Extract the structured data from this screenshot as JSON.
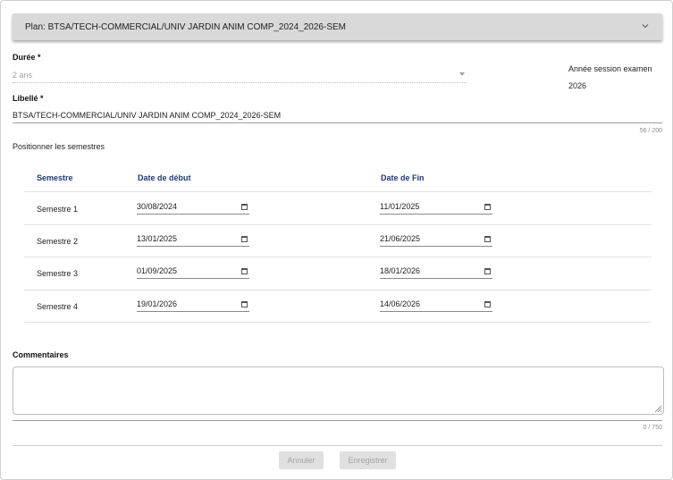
{
  "plan_header": {
    "title": "Plan: BTSA/TECH-COMMERCIAL/UNIV JARDIN ANIM COMP_2024_2026-SEM"
  },
  "duree": {
    "label": "Durée *",
    "value": "2 ans"
  },
  "annee_session": {
    "label": "Année session examen",
    "value": "2026"
  },
  "libelle": {
    "label": "Libellé *",
    "value": "BTSA/TECH-COMMERCIAL/UNIV JARDIN ANIM COMP_2024_2026-SEM",
    "counter": "56 / 200"
  },
  "semestres": {
    "section_label": "Positionner les semestres",
    "headers": {
      "semestre": "Semestre",
      "debut": "Date de début",
      "fin": "Date de Fin"
    },
    "rows": [
      {
        "name": "Semestre 1",
        "debut": "30/08/2024",
        "fin": "11/01/2025"
      },
      {
        "name": "Semestre 2",
        "debut": "13/01/2025",
        "fin": "21/06/2025"
      },
      {
        "name": "Semestre 3",
        "debut": "01/09/2025",
        "fin": "18/01/2026"
      },
      {
        "name": "Semestre 4",
        "debut": "19/01/2026",
        "fin": "14/06/2026"
      }
    ]
  },
  "commentaires": {
    "label": "Commentaires",
    "value": "",
    "counter": "0 / 750"
  },
  "actions": {
    "cancel_label": "Annuler",
    "save_label": "Enregistrer"
  },
  "colors": {
    "header_bg": "#d9d9d9",
    "table_header_text": "#1e3a78",
    "disabled_button_bg": "#e0e0e0"
  },
  "icons": {
    "plan_chevron": "chevron-down-icon",
    "date_picker": "calendar-icon",
    "select_arrow": "caret-down-icon"
  }
}
